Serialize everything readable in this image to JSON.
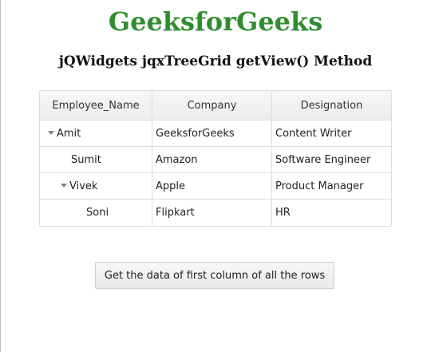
{
  "page": {
    "title": "GeeksforGeeks",
    "subtitle": "jQWidgets jqxTreeGrid getView() Method"
  },
  "treegrid": {
    "columns": [
      "Employee_Name",
      "Company",
      "Designation"
    ],
    "rows": [
      {
        "name": "Amit",
        "company": "GeeksforGeeks",
        "designation": "Content Writer",
        "level": 0,
        "expanded": true,
        "has_children": true
      },
      {
        "name": "Sumit",
        "company": "Amazon",
        "designation": "Software Engineer",
        "level": 1,
        "expanded": false,
        "has_children": false
      },
      {
        "name": "Vivek",
        "company": "Apple",
        "designation": "Product Manager",
        "level": 1,
        "expanded": true,
        "has_children": true
      },
      {
        "name": "Soni",
        "company": "Flipkart",
        "designation": "HR",
        "level": 2,
        "expanded": false,
        "has_children": false
      }
    ],
    "toggle_icon": "triangle-down-icon"
  },
  "button": {
    "label": "Get the data of first column of all the rows"
  },
  "colors": {
    "title": "#2f8d2f",
    "grid_border": "#dddddd",
    "header_bg": "#f2f2f2",
    "toggle": "#808080"
  }
}
